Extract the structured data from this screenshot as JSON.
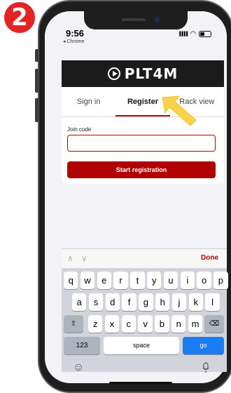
{
  "step_badge": "2",
  "status_bar": {
    "time": "9:56",
    "back_app": "◂ Chrome",
    "signal": "▐▐▐▐",
    "wifi": "◠"
  },
  "app": {
    "brand": "PLT4M",
    "tabs": [
      {
        "label": "Sign in",
        "active": false
      },
      {
        "label": "Register",
        "active": true
      },
      {
        "label": "Rack view",
        "active": false
      }
    ],
    "join_code_label": "Join code",
    "join_code_value": "",
    "start_button": "Start registration",
    "accent_color": "#b00000",
    "highlight_arrow_color": "#f7d44a"
  },
  "keyboard": {
    "toolbar": {
      "up": "∧",
      "down": "∨",
      "done": "Done"
    },
    "row1": [
      "q",
      "w",
      "e",
      "r",
      "t",
      "y",
      "u",
      "i",
      "o",
      "p"
    ],
    "row2": [
      "a",
      "s",
      "d",
      "f",
      "g",
      "h",
      "j",
      "k",
      "l"
    ],
    "row3": [
      "z",
      "x",
      "c",
      "v",
      "b",
      "n",
      "m"
    ],
    "shift": "⇧",
    "backspace": "⌫",
    "numbers": "123",
    "space": "space",
    "go": "go",
    "emoji": "☺",
    "mic": "🎙"
  }
}
